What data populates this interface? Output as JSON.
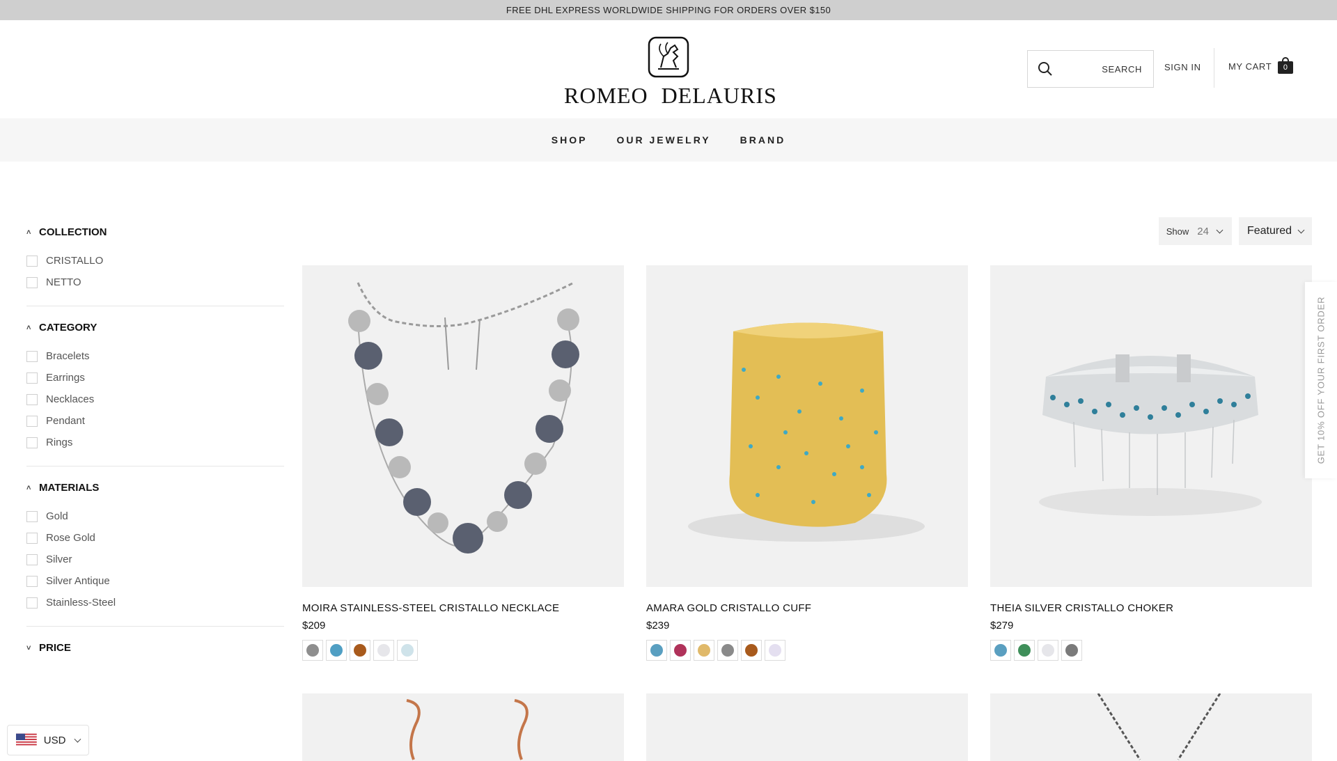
{
  "promo": {
    "text": "FREE DHL EXPRESS WORLDWIDE SHIPPING FOR ORDERS OVER $150"
  },
  "brand": {
    "name": "ROMEO   DELAURIS"
  },
  "header": {
    "search_label": "SEARCH",
    "sign_in": "SIGN IN",
    "cart_label": "MY CART",
    "cart_count": "0"
  },
  "nav": {
    "items": [
      "SHOP",
      "OUR JEWELRY",
      "BRAND"
    ]
  },
  "filters": {
    "collection": {
      "title": "COLLECTION",
      "options": [
        "CRISTALLO",
        "NETTO"
      ]
    },
    "category": {
      "title": "CATEGORY",
      "options": [
        "Bracelets",
        "Earrings",
        "Necklaces",
        "Pendant",
        "Rings"
      ]
    },
    "materials": {
      "title": "MATERIALS",
      "options": [
        "Gold",
        "Rose Gold",
        "Silver",
        "Silver Antique",
        "Stainless-Steel"
      ]
    },
    "price": {
      "title": "PRICE"
    }
  },
  "sort": {
    "show_label": "Show",
    "show_value": "24",
    "sort_value": "Featured"
  },
  "products": [
    {
      "name": "MOIRA STAINLESS-STEEL CRISTALLO NECKLACE",
      "price": "$209",
      "swatches": [
        "#8e8e8e",
        "#4f9fc4",
        "#a85a1c",
        "#e6e6ea",
        "#cfe3ea"
      ]
    },
    {
      "name": "AMARA GOLD CRISTALLO CUFF",
      "price": "$239",
      "swatches": [
        "#5a9fc0",
        "#b0325a",
        "#e0b96a",
        "#8a8a8a",
        "#a85a1c",
        "#e4dff0"
      ]
    },
    {
      "name": "THEIA SILVER CRISTALLO CHOKER",
      "price": "$279",
      "swatches": [
        "#5a9fc0",
        "#3f8f5a",
        "#e6e6ea",
        "#7a7a7a"
      ]
    }
  ],
  "side_tab": {
    "text": "GET 10% OFF YOUR FIRST ORDER"
  },
  "currency": {
    "code": "USD"
  },
  "colors": {
    "promo_bg": "#cfcfcf",
    "nav_bg": "#f6f6f6",
    "image_bg": "#f1f1f1"
  }
}
